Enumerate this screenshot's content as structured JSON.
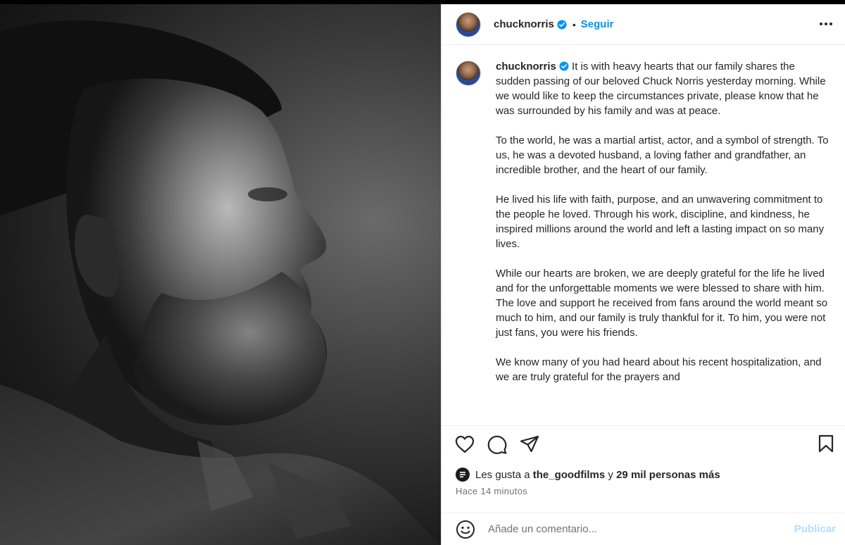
{
  "header": {
    "username": "chucknorris",
    "separator": "•",
    "follow_label": "Seguir"
  },
  "caption": {
    "username": "chucknorris",
    "paragraphs": [
      "It is with heavy hearts that our family shares the sudden passing of our beloved Chuck Norris yesterday morning. While we would like to keep the circumstances private, please know that he was surrounded by his family and was at peace.",
      "To the world, he was a martial artist, actor, and a symbol of strength. To us, he was a devoted husband, a loving father and grandfather, an incredible brother, and the heart of our family.",
      "He lived his life with faith, purpose, and an unwavering commitment to the people he loved. Through his work, discipline, and kindness, he inspired millions around the world and left a lasting impact on so many lives.",
      "While our hearts are broken, we are deeply grateful for the life he lived and for the unforgettable moments we were blessed to share with him. The love and support he received from fans around the world meant so much to him, and our family is truly thankful for it. To him, you were not just fans, you were his friends.",
      "We know many of you had heard about his recent hospitalization, and we are truly grateful for the prayers and"
    ]
  },
  "likes": {
    "prefix": "Les gusta a",
    "liker": "the_goodfilms",
    "connector": "y",
    "others": "29 mil personas más"
  },
  "timestamp": "Hace 14 minutos",
  "comment": {
    "placeholder": "Añade un comentario...",
    "publish_label": "Publicar"
  },
  "colors": {
    "follow_blue": "#0095f6",
    "verified_blue": "#0095f6",
    "publish_disabled": "#b2dffc"
  }
}
